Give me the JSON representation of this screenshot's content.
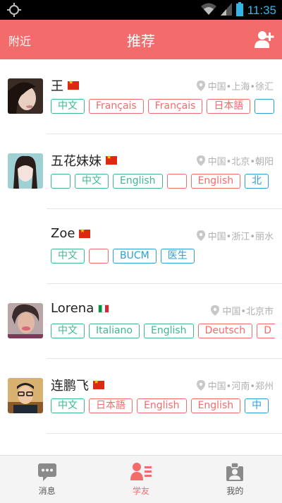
{
  "status_bar": {
    "time": "11:35"
  },
  "header": {
    "left_link": "附近",
    "title": "推荐"
  },
  "users": [
    {
      "name": "王",
      "flag": "cn",
      "location": "中国•上海•徐汇",
      "tags": [
        {
          "label": "中文",
          "color": "green"
        },
        {
          "label": "Français",
          "color": "red"
        },
        {
          "label": "Français",
          "color": "red"
        },
        {
          "label": "日本語",
          "color": "red"
        },
        {
          "label": "",
          "color": "blue"
        }
      ]
    },
    {
      "name": "五花妹妹",
      "flag": "cn",
      "location": "中国•北京•朝阳",
      "tags": [
        {
          "label": "",
          "color": "green"
        },
        {
          "label": "中文",
          "color": "green"
        },
        {
          "label": "English",
          "color": "green"
        },
        {
          "label": "",
          "color": "red"
        },
        {
          "label": "English",
          "color": "red"
        },
        {
          "label": "北",
          "color": "blue"
        }
      ]
    },
    {
      "name": "Zoe",
      "flag": "cn",
      "location": "中国•浙江•丽水",
      "tags": [
        {
          "label": "中文",
          "color": "green"
        },
        {
          "label": "",
          "color": "red"
        },
        {
          "label": "BUCM",
          "color": "blue"
        },
        {
          "label": "医生",
          "color": "blue"
        }
      ]
    },
    {
      "name": "Lorena",
      "flag": "it",
      "location": "中国•北京市",
      "tags": [
        {
          "label": "中文",
          "color": "green"
        },
        {
          "label": "Italiano",
          "color": "green"
        },
        {
          "label": "English",
          "color": "green"
        },
        {
          "label": "Deutsch",
          "color": "red"
        },
        {
          "label": "D",
          "color": "red"
        }
      ]
    },
    {
      "name": "连鹏飞",
      "flag": "cn",
      "location": "中国•河南•郑州",
      "tags": [
        {
          "label": "中文",
          "color": "green"
        },
        {
          "label": "日本語",
          "color": "red"
        },
        {
          "label": "English",
          "color": "red"
        },
        {
          "label": "English",
          "color": "red"
        },
        {
          "label": "中",
          "color": "blue"
        }
      ]
    }
  ],
  "bottom_nav": [
    {
      "label": "消息",
      "icon": "chat-icon",
      "active": false
    },
    {
      "label": "学友",
      "icon": "contacts-icon",
      "active": true
    },
    {
      "label": "我的",
      "icon": "profile-icon",
      "active": false
    }
  ],
  "colors": {
    "accent": "#f36c6c",
    "green": "#3fb890",
    "blue": "#2f9ed6",
    "status_icons": "#33b5e5"
  }
}
